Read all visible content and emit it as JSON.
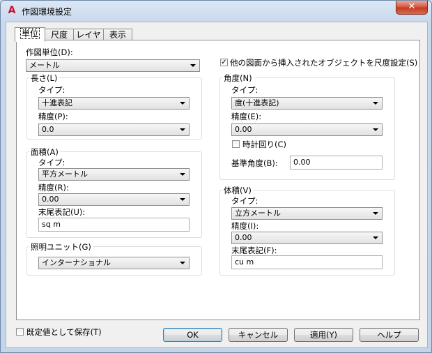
{
  "window": {
    "title": "作図環境設定",
    "icon": "autocad-a-icon",
    "close_glyph": "✕"
  },
  "tabs": [
    "単位",
    "尺度",
    "レイヤ",
    "表示"
  ],
  "drawing_units": {
    "label": "作図単位(D):",
    "value": "メートル"
  },
  "scale_inserted": {
    "label": "他の図面から挿入されたオブジェクトを尺度設定(S)",
    "checked": true
  },
  "length": {
    "title": "長さ(L)",
    "type_label": "タイプ:",
    "type_value": "十進表記",
    "precision_label": "精度(P):",
    "precision_value": "0.0"
  },
  "angle": {
    "title": "角度(N)",
    "type_label": "タイプ:",
    "type_value": "度(十進表記)",
    "precision_label": "精度(E):",
    "precision_value": "0.00",
    "clockwise_label": "時計回り(C)",
    "clockwise_checked": false,
    "base_angle_label": "基準角度(B):",
    "base_angle_value": "0.00"
  },
  "area": {
    "title": "面積(A)",
    "type_label": "タイプ:",
    "type_value": "平方メートル",
    "precision_label": "精度(R):",
    "precision_value": "0.00",
    "suffix_label": "末尾表記(U):",
    "suffix_value": "sq m"
  },
  "volume": {
    "title": "体積(V)",
    "type_label": "タイプ:",
    "type_value": "立方メートル",
    "precision_label": "精度(I):",
    "precision_value": "0.00",
    "suffix_label": "末尾表記(F):",
    "suffix_value": "cu m"
  },
  "lighting": {
    "title": "照明ユニット(G)",
    "value": "インターナショナル"
  },
  "save_default": {
    "label": "既定値として保存(T)",
    "checked": false
  },
  "buttons": {
    "ok": "OK",
    "cancel": "キャンセル",
    "apply": "適用(Y)",
    "help": "ヘルプ"
  }
}
